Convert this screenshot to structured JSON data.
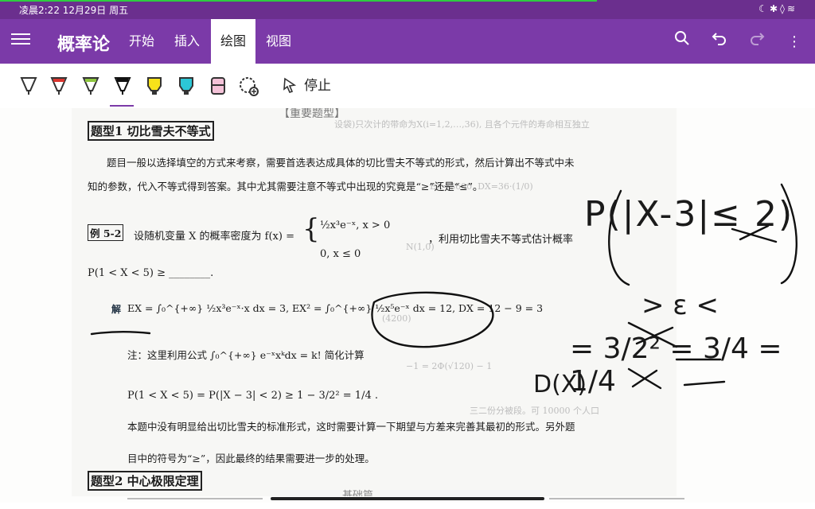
{
  "status_bar": {
    "time": "凌晨2:22 12月29日 周五",
    "icons": [
      "moon-icon",
      "bluetooth-icon",
      "bell-off-icon",
      "wifi-icon"
    ]
  },
  "app_bar": {
    "title": "概率论",
    "tabs": [
      {
        "label": "开始",
        "active": false
      },
      {
        "label": "插入",
        "active": false
      },
      {
        "label": "绘图",
        "active": true
      },
      {
        "label": "视图",
        "active": false
      }
    ],
    "actions": [
      "search-icon",
      "undo-icon",
      "redo-icon",
      "more-icon"
    ],
    "colors": {
      "accent": "#7b3aa8",
      "status": "#6b2f8e"
    }
  },
  "drawing_toolbar": {
    "tools": [
      {
        "name": "pen-gray",
        "color": "#ffffff"
      },
      {
        "name": "pen-red",
        "color": "#d9352f"
      },
      {
        "name": "pen-green",
        "color": "#8dc63f"
      },
      {
        "name": "pen-black",
        "color": "#111111"
      },
      {
        "name": "highlighter-yellow",
        "color": "#f7e21a"
      },
      {
        "name": "highlighter-cyan",
        "color": "#2cc7d6"
      },
      {
        "name": "highlighter-pink",
        "color": "#f4c2d8"
      },
      {
        "name": "add-pen",
        "color": "#555555"
      }
    ],
    "stop_label": "停止"
  },
  "document": {
    "header_ghost": "【重要题型】",
    "q1_title": "题型1  切比雪夫不等式",
    "para1_line1": "题目一般以选择填空的方式来考察，需要首选表达成具体的切比雪夫不等式的形式，然后计算出不等式中未",
    "para1_line2": "知的参数，代入不等式得到答案。其中尤其需要注意不等式中出现的究竟是“≥”还是“≤”。",
    "example_label": "例 5-2",
    "example_text": "设随机变量 X 的概率密度为 f(x) =",
    "case1": "½x³e⁻ˣ,   x > 0",
    "case2": "0,         x ≤ 0",
    "example_tail": "，利用切比雪夫不等式估计概率",
    "blank_line": "P(1 < X < 5) ≥ ________.",
    "solution_label": "解",
    "solution_line": "EX = ∫₀^{+∞} ½x³e⁻ˣ·x dx = 3, EX² = ∫₀^{+∞} ½x⁵e⁻ˣ dx = 12, DX = 12 − 9 = 3",
    "note": "注：这里利用公式 ∫₀^{+∞} e⁻ˣxᵏdx = k! 简化计算",
    "result": "P(1 < X < 5) = P(|X − 3| < 2) ≥ 1 − 3/2² = 1/4 .",
    "conclusion_line1": "本题中没有明显给出切比雪夫的标准形式，这时需要计算一下期望与方差来完善其最初的形式。另外题",
    "conclusion_line2": "目中的符号为“≥”，因此最终的结果需要进一步的处理。",
    "q2_title": "题型2  中心极限定理",
    "footer_ghost": "基础篇"
  },
  "handwriting": {
    "line1": "P(|X-3|≤ 2)",
    "line2": "> ε <",
    "line3": "= 3/2² = 3/4 = 1/4",
    "line4": "D(X)"
  }
}
